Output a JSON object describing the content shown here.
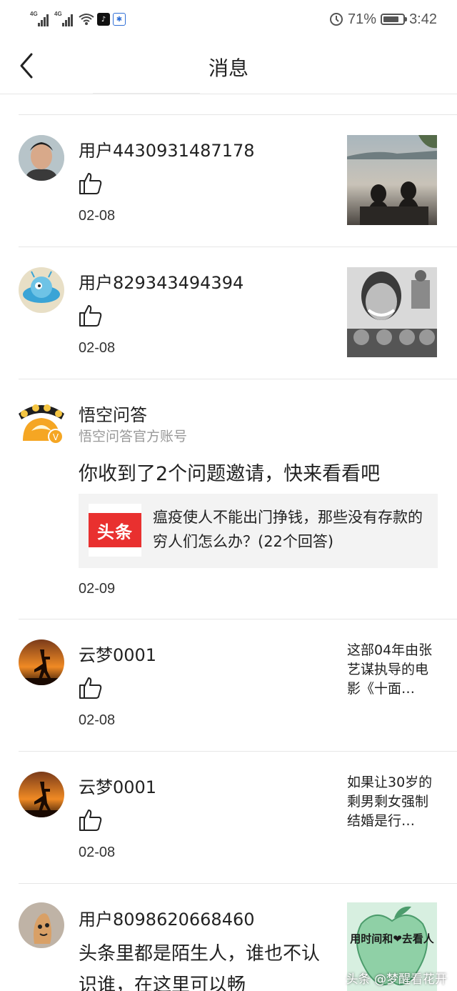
{
  "status_bar": {
    "network1": "4G",
    "network2": "4G",
    "battery": "71%",
    "battery_level": 0.71,
    "time": "3:42"
  },
  "header": {
    "title": "消息"
  },
  "messages": [
    {
      "name": "用户4430931487178",
      "date": "02-08",
      "icon": "thumbs-up-icon"
    },
    {
      "name": "用户829343494394",
      "date": "02-08",
      "icon": "thumbs-up-icon"
    },
    {
      "name": "悟空问答",
      "subtitle": "悟空问答官方账号",
      "text": "你收到了2个问题邀请，快来看看吧",
      "card": {
        "logo_text": "头条",
        "text": "瘟疫使人不能出门挣钱，那些没有存款的穷人们怎么办？(22个回答)"
      },
      "date": "02-09"
    },
    {
      "name": "云梦0001",
      "date": "02-08",
      "snippet": "这部04年由张艺谋执导的电影《十面…",
      "icon": "thumbs-up-icon"
    },
    {
      "name": "云梦0001",
      "date": "02-08",
      "snippet": "如果让30岁的剩男剩女强制结婚是行…",
      "icon": "thumbs-up-icon"
    },
    {
      "name": "用户8098620668460",
      "text": "头条里都是陌生人，谁也不认识谁，在这里可以畅",
      "thumb_caption": "用时间和❤去看人"
    }
  ],
  "watermark": "头条 @梦醒看花开",
  "colors": {
    "toutiao_red": "#e9302f",
    "divider": "#e6e6e6",
    "card_bg": "#f3f3f3",
    "subtitle_gray": "#999999"
  }
}
